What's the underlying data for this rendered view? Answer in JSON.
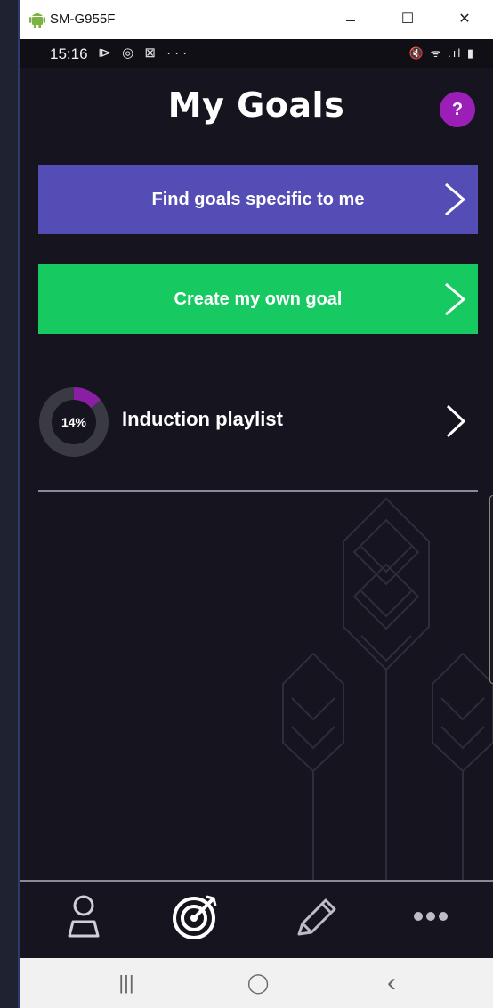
{
  "window": {
    "title": "SM-G955F",
    "minimize_glyph": "–",
    "maximize_glyph": "☐",
    "close_glyph": "✕"
  },
  "status_bar": {
    "time": "15:16",
    "left_icons": "⧐ ◎ ⊠ ···",
    "right_icons": "🔇 ᯤ .ıl ▮"
  },
  "header": {
    "title": "My Goals",
    "help_label": "?"
  },
  "actions": {
    "find_goals": {
      "label": "Find goals specific to me",
      "color": "#534db5"
    },
    "create_goal": {
      "label": "Create my own goal",
      "color": "#16c960"
    }
  },
  "goals": [
    {
      "title": "Induction playlist",
      "progress_label": "14%",
      "progress": 0.14,
      "accent": "#8a1fa3"
    }
  ],
  "bottom_nav": {
    "items": [
      {
        "name": "profile",
        "icon": "person-icon"
      },
      {
        "name": "goals",
        "icon": "target-icon"
      },
      {
        "name": "edit",
        "icon": "pencil-icon"
      },
      {
        "name": "more",
        "icon": "more-dots-icon"
      }
    ]
  },
  "android_nav": {
    "recents": "|||",
    "home": "◯",
    "back": "‹"
  }
}
